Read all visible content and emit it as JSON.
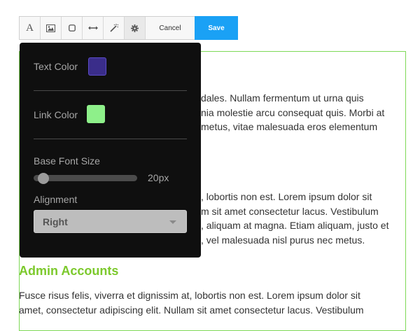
{
  "toolbar": {
    "buttons": [
      {
        "icon": "text-format-icon",
        "glyph": "A"
      },
      {
        "icon": "image-icon"
      },
      {
        "icon": "border-style-icon"
      },
      {
        "icon": "horizontal-rule-icon"
      },
      {
        "icon": "magic-wand-icon"
      },
      {
        "icon": "gear-icon"
      }
    ],
    "cancel_label": "Cancel",
    "save_label": "Save",
    "save_color": "#1aa1f5"
  },
  "settings": {
    "text_color_label": "Text Color",
    "text_color": "#3a2d8a",
    "link_color_label": "Link Color",
    "link_color": "#8ef08a",
    "font_size_label": "Base Font Size",
    "font_size_value": "20px",
    "alignment_label": "Alignment",
    "alignment_value": "Right"
  },
  "document": {
    "border_color": "#7ed957",
    "heading_color": "#7cc92c",
    "para1": {
      "line1": "dales. Nullam fermentum ut urna quis",
      "line2": "nia molestie arcu consequat quis. Morbi at",
      "line3": "metus, vitae malesuada eros elementum"
    },
    "para2": {
      "line1": ", lobortis non est. Lorem ipsum dolor sit",
      "line2": "m sit amet consectetur lacus. Vestibulum",
      "line3": ", aliquam at magna. Etiam aliquam, justo et",
      "line4": ", vel malesuada nisl purus nec metus."
    },
    "heading": "Admin Accounts",
    "para3": {
      "line1": "Fusce risus felis, viverra et dignissim at, lobortis non est. Lorem ipsum dolor sit",
      "line2": "amet, consectetur adipiscing elit. Nullam sit amet consectetur lacus. Vestibulum"
    }
  }
}
